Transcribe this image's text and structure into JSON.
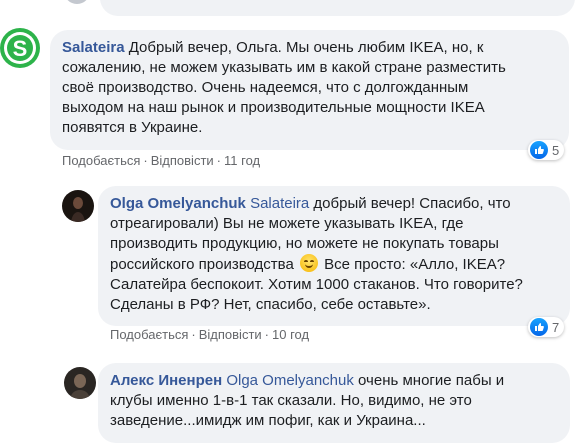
{
  "comments": [
    {
      "author": "Salateira",
      "lines": [
        " Добрый вечер, Ольга. Мы очень любим IKEA, но, к",
        "сожалению, не можем указывать им в какой стране разместить",
        "своё производство. Очень надеемся, что с долгожданным",
        "выходом на наш рынок и производительные мощности IKEA",
        "появятся в Украине."
      ],
      "actions": {
        "like": "Подобається",
        "reply": "Відповісти",
        "time": "11 год"
      },
      "reaction_count": "5"
    },
    {
      "author": "Olga Omelyanchuk",
      "mention": "Salateira",
      "lines": [
        " добрый вечер! Спасибо, что",
        "отреагировали) Вы не можете указывать IKEA, где",
        "производить продукцию, но можете не покупать товары",
        "российского производства",
        " Все просто: «Алло, IKEA?",
        "Салатейра беспокоит. Хотим 1000 стаканов. Что говорите?",
        "Сделаны в РФ? Нет, спасибо, себе оставьте»."
      ],
      "actions": {
        "like": "Подобається",
        "reply": "Відповісти",
        "time": "10 год"
      },
      "reaction_count": "7",
      "emoji": "smiling-face-emoji"
    },
    {
      "author": "Алекс Иненрен",
      "mention": "Olga Omelyanchuk",
      "lines": [
        " очень многие пабы и",
        "клубы именно 1-в-1 так сказали. Но, видимо, не это",
        "заведение...имидж им пофиг, как и Украина..."
      ]
    }
  ],
  "colors": {
    "bubble": "#f0f2f5",
    "name": "#365899",
    "meta": "#65676b",
    "like": "#1877f2",
    "salateira_logo": "#2db34a"
  },
  "icons": [
    "like-icon",
    "salateira-logo-icon",
    "emoji-icon"
  ],
  "separator": "·"
}
